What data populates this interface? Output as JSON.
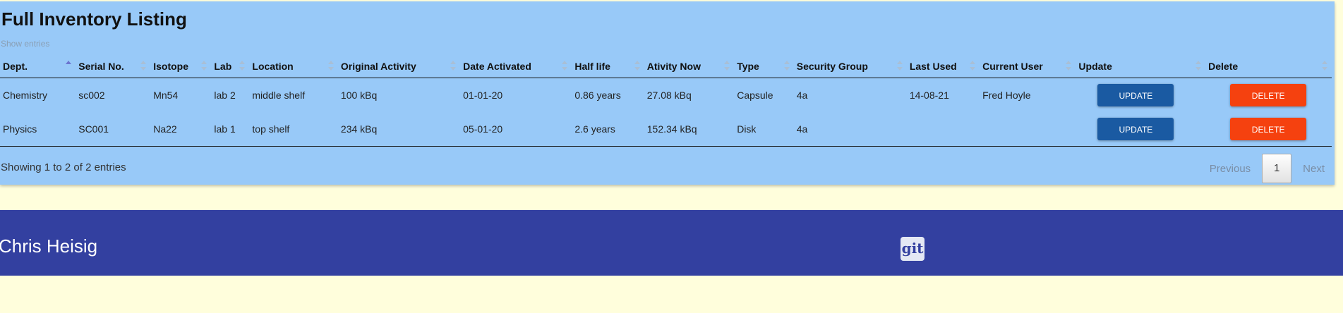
{
  "panel": {
    "title": "Full Inventory Listing",
    "show_entries": "Show entries"
  },
  "table": {
    "columns": [
      "Dept.",
      "Serial No.",
      "Isotope",
      "Lab",
      "Location",
      "Original Activity",
      "Date Activated",
      "Half life",
      "Ativity Now",
      "Type",
      "Security Group",
      "Last Used",
      "Current User",
      "Update",
      "Delete"
    ],
    "rows": [
      {
        "dept": "Chemistry",
        "serial": "sc002",
        "isotope": "Mn54",
        "lab": "lab 2",
        "location": "middle shelf",
        "original_activity": "100 kBq",
        "date_activated": "01-01-20",
        "half_life": "0.86 years",
        "activity_now": "27.08 kBq",
        "type": "Capsule",
        "security_group": "4a",
        "last_used": "14-08-21",
        "current_user": "Fred Hoyle",
        "update_label": "UPDATE",
        "delete_label": "DELETE"
      },
      {
        "dept": "Physics",
        "serial": "SC001",
        "isotope": "Na22",
        "lab": "lab 1",
        "location": "top shelf",
        "original_activity": "234 kBq",
        "date_activated": "05-01-20",
        "half_life": "2.6 years",
        "activity_now": "152.34 kBq",
        "type": "Disk",
        "security_group": "4a",
        "last_used": "",
        "current_user": "",
        "update_label": "UPDATE",
        "delete_label": "DELETE"
      }
    ],
    "sorted_column": "Dept.",
    "sort_direction": "ascending"
  },
  "footer_info": {
    "showing": "Showing 1 to 2 of 2 entries"
  },
  "pagination": {
    "previous": "Previous",
    "current_page": "1",
    "next": "Next"
  },
  "footer": {
    "author": "Chris Heisig",
    "git_label": "git"
  },
  "colors": {
    "panel_bg": "#98c9f8",
    "page_bg": "#fffedc",
    "footer_bg": "#3340a0",
    "update_button": "#1a5aa2",
    "delete_button": "#f5410f"
  }
}
